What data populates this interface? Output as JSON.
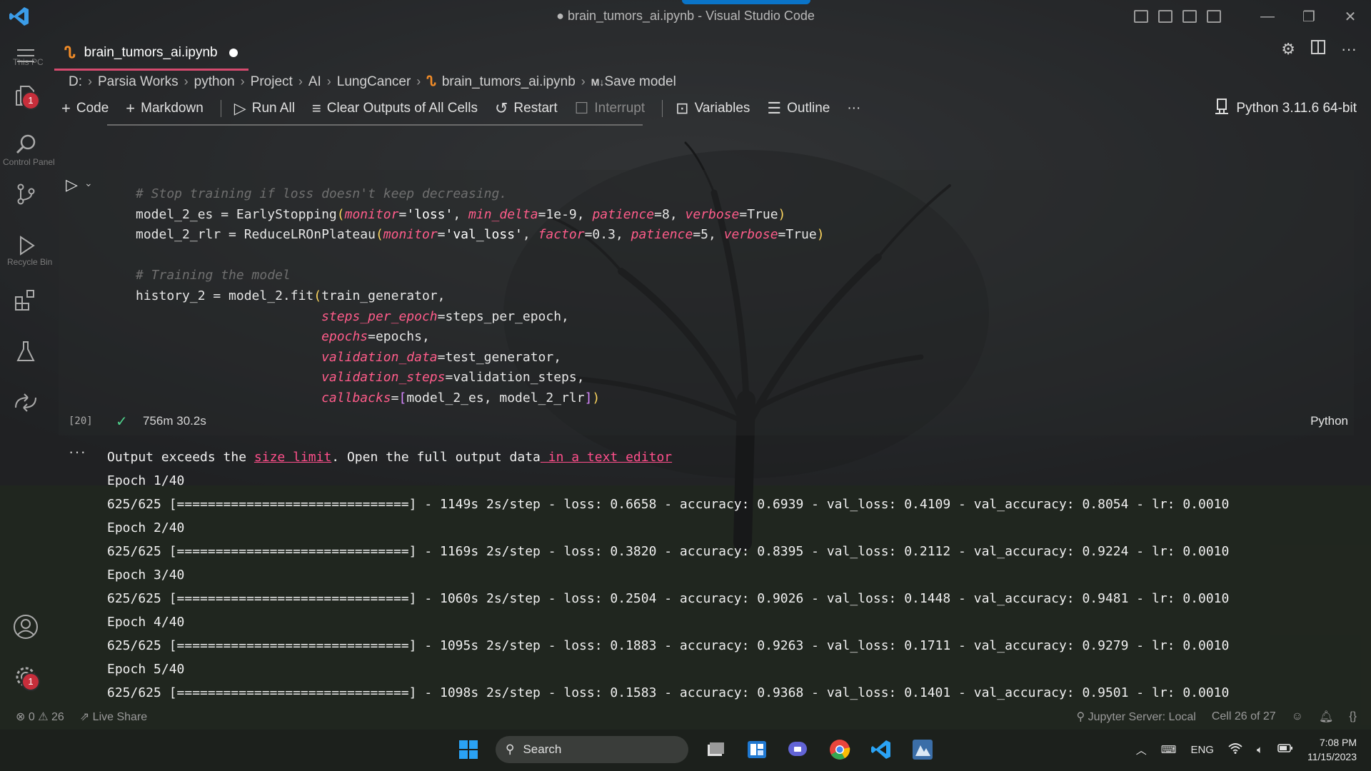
{
  "window": {
    "title": "● brain_tumors_ai.ipynb - Visual Studio Code",
    "accent": "#0a74c8"
  },
  "desktop_labels": [
    "This PC",
    "Control Panel",
    "Recycle Bin"
  ],
  "activity_bar": {
    "explorer_badge": "1",
    "manage_badge": "1"
  },
  "tab": {
    "name": "brain_tumors_ai.ipynb"
  },
  "breadcrumb": {
    "items": [
      "D:",
      "Parsia Works",
      "python",
      "Project",
      "AI",
      "LungCancer",
      "brain_tumors_ai.ipynb",
      "Save model"
    ],
    "md_prefix": "M↓"
  },
  "toolbar": {
    "code": "Code",
    "markdown": "Markdown",
    "run_all": "Run All",
    "clear_outputs": "Clear Outputs of All Cells",
    "restart": "Restart",
    "interrupt": "Interrupt",
    "variables": "Variables",
    "outline": "Outline",
    "more": "···"
  },
  "kernel": "Python 3.11.6 64-bit",
  "cell": {
    "comment1": "# Stop training if loss doesn't keep decreasing.",
    "comment2": "# Training the model",
    "exec_count": "[20]",
    "duration": "756m 30.2s",
    "language": "Python"
  },
  "output": {
    "more": "···",
    "notice_pre": "Output exceeds the ",
    "notice_link1": "size limit",
    "notice_mid": ". Open the full output data",
    "notice_link2": " in a text editor",
    "lines": [
      "Epoch 1/40",
      "625/625 [==============================] - 1149s 2s/step - loss: 0.6658 - accuracy: 0.6939 - val_loss: 0.4109 - val_accuracy: 0.8054 - lr: 0.0010",
      "Epoch 2/40",
      "625/625 [==============================] - 1169s 2s/step - loss: 0.3820 - accuracy: 0.8395 - val_loss: 0.2112 - val_accuracy: 0.9224 - lr: 0.0010",
      "Epoch 3/40",
      "625/625 [==============================] - 1060s 2s/step - loss: 0.2504 - accuracy: 0.9026 - val_loss: 0.1448 - val_accuracy: 0.9481 - lr: 0.0010",
      "Epoch 4/40",
      "625/625 [==============================] - 1095s 2s/step - loss: 0.1883 - accuracy: 0.9263 - val_loss: 0.1711 - val_accuracy: 0.9279 - lr: 0.0010",
      "Epoch 5/40",
      "625/625 [==============================] - 1098s 2s/step - loss: 0.1583 - accuracy: 0.9368 - val_loss: 0.1401 - val_accuracy: 0.9501 - lr: 0.0010"
    ]
  },
  "statusbar": {
    "errors": "0",
    "warnings": "26",
    "live_share": "Live Share",
    "jupyter": "Jupyter Server: Local",
    "cell_pos": "Cell 26 of 27"
  },
  "taskbar": {
    "search": "Search",
    "lang": "ENG",
    "time": "7:08 PM",
    "date": "11/15/2023"
  }
}
